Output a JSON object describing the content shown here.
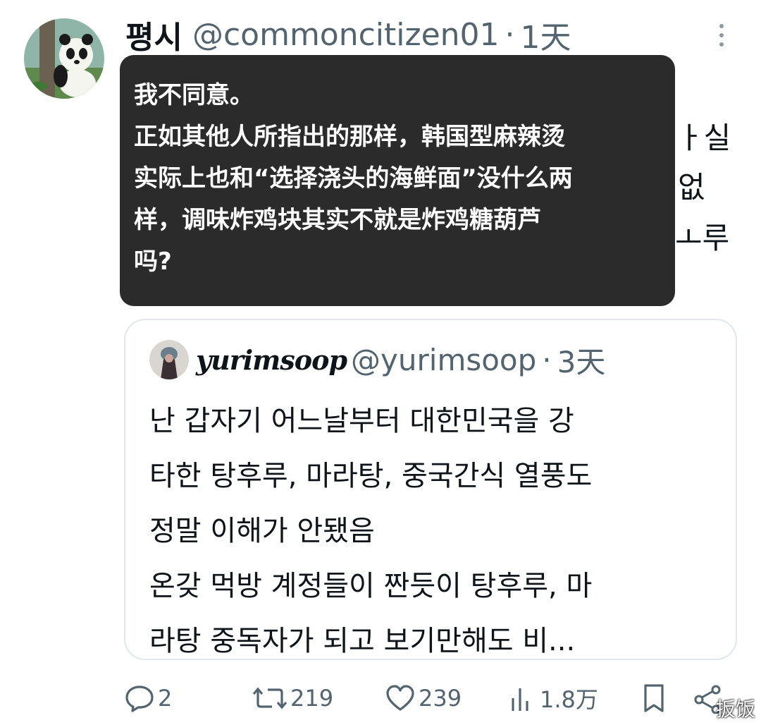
{
  "tweet": {
    "display_name": "평시",
    "handle": "@commoncitizen01",
    "separator": "·",
    "time": "1天",
    "original_text_peek": [
      "ㅏ실",
      "없",
      "ㅗ루"
    ]
  },
  "translation": {
    "lines": [
      "我不同意。",
      "正如其他人所指出的那样，韩国型麻辣烫",
      "实际上也和“选择浇头的海鲜面”没什么两",
      "样，调味炸鸡块其实不就是炸鸡糖葫芦",
      "吗?"
    ]
  },
  "quoted": {
    "display_name": "yurimsoop",
    "handle": "@yurimsoop",
    "separator": "·",
    "time": "3天",
    "lines": [
      "난 갑자기 어느날부터 대한민국을 강",
      "타한 탕후루, 마라탕, 중국간식 열풍도",
      "정말 이해가 안됐음",
      "온갖 먹방 계정들이 짠듯이 탕후루, 마",
      "라탕 중독자가 되고 보기만해도 비..."
    ]
  },
  "actions": {
    "reply_count": "2",
    "retweet_count": "219",
    "like_count": "239",
    "views_count": "1.8万"
  },
  "watermark": "扳饭",
  "icons": {
    "reply": "speech-bubble-icon",
    "retweet": "retweet-icon",
    "like": "heart-icon",
    "views": "bar-chart-icon",
    "bookmark": "bookmark-icon",
    "share": "share-icon",
    "more": "more-vertical-icon"
  },
  "colors": {
    "text": "#0f1419",
    "secondary": "#536471",
    "overlay_bg": "#2b2b2b",
    "border": "#e1e8ed"
  }
}
